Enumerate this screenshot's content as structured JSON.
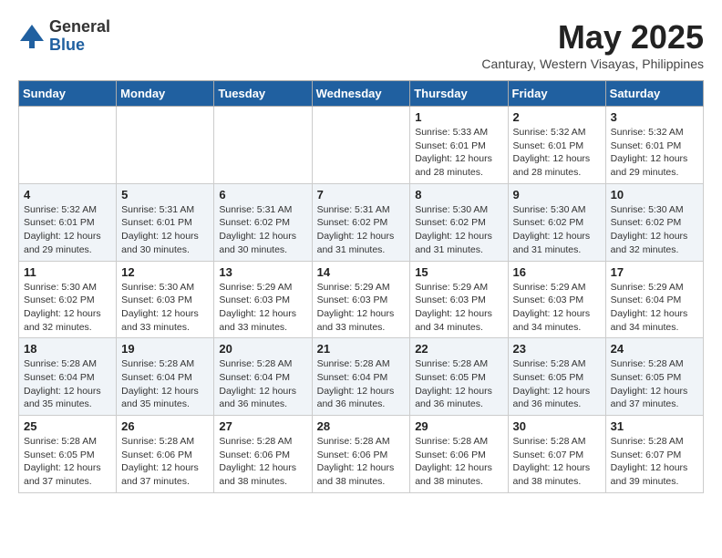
{
  "logo": {
    "general": "General",
    "blue": "Blue"
  },
  "title": "May 2025",
  "location": "Canturay, Western Visayas, Philippines",
  "days_header": [
    "Sunday",
    "Monday",
    "Tuesday",
    "Wednesday",
    "Thursday",
    "Friday",
    "Saturday"
  ],
  "weeks": [
    [
      {
        "day": "",
        "content": ""
      },
      {
        "day": "",
        "content": ""
      },
      {
        "day": "",
        "content": ""
      },
      {
        "day": "",
        "content": ""
      },
      {
        "day": "1",
        "content": "Sunrise: 5:33 AM\nSunset: 6:01 PM\nDaylight: 12 hours\nand 28 minutes."
      },
      {
        "day": "2",
        "content": "Sunrise: 5:32 AM\nSunset: 6:01 PM\nDaylight: 12 hours\nand 28 minutes."
      },
      {
        "day": "3",
        "content": "Sunrise: 5:32 AM\nSunset: 6:01 PM\nDaylight: 12 hours\nand 29 minutes."
      }
    ],
    [
      {
        "day": "4",
        "content": "Sunrise: 5:32 AM\nSunset: 6:01 PM\nDaylight: 12 hours\nand 29 minutes."
      },
      {
        "day": "5",
        "content": "Sunrise: 5:31 AM\nSunset: 6:01 PM\nDaylight: 12 hours\nand 30 minutes."
      },
      {
        "day": "6",
        "content": "Sunrise: 5:31 AM\nSunset: 6:02 PM\nDaylight: 12 hours\nand 30 minutes."
      },
      {
        "day": "7",
        "content": "Sunrise: 5:31 AM\nSunset: 6:02 PM\nDaylight: 12 hours\nand 31 minutes."
      },
      {
        "day": "8",
        "content": "Sunrise: 5:30 AM\nSunset: 6:02 PM\nDaylight: 12 hours\nand 31 minutes."
      },
      {
        "day": "9",
        "content": "Sunrise: 5:30 AM\nSunset: 6:02 PM\nDaylight: 12 hours\nand 31 minutes."
      },
      {
        "day": "10",
        "content": "Sunrise: 5:30 AM\nSunset: 6:02 PM\nDaylight: 12 hours\nand 32 minutes."
      }
    ],
    [
      {
        "day": "11",
        "content": "Sunrise: 5:30 AM\nSunset: 6:02 PM\nDaylight: 12 hours\nand 32 minutes."
      },
      {
        "day": "12",
        "content": "Sunrise: 5:30 AM\nSunset: 6:03 PM\nDaylight: 12 hours\nand 33 minutes."
      },
      {
        "day": "13",
        "content": "Sunrise: 5:29 AM\nSunset: 6:03 PM\nDaylight: 12 hours\nand 33 minutes."
      },
      {
        "day": "14",
        "content": "Sunrise: 5:29 AM\nSunset: 6:03 PM\nDaylight: 12 hours\nand 33 minutes."
      },
      {
        "day": "15",
        "content": "Sunrise: 5:29 AM\nSunset: 6:03 PM\nDaylight: 12 hours\nand 34 minutes."
      },
      {
        "day": "16",
        "content": "Sunrise: 5:29 AM\nSunset: 6:03 PM\nDaylight: 12 hours\nand 34 minutes."
      },
      {
        "day": "17",
        "content": "Sunrise: 5:29 AM\nSunset: 6:04 PM\nDaylight: 12 hours\nand 34 minutes."
      }
    ],
    [
      {
        "day": "18",
        "content": "Sunrise: 5:28 AM\nSunset: 6:04 PM\nDaylight: 12 hours\nand 35 minutes."
      },
      {
        "day": "19",
        "content": "Sunrise: 5:28 AM\nSunset: 6:04 PM\nDaylight: 12 hours\nand 35 minutes."
      },
      {
        "day": "20",
        "content": "Sunrise: 5:28 AM\nSunset: 6:04 PM\nDaylight: 12 hours\nand 36 minutes."
      },
      {
        "day": "21",
        "content": "Sunrise: 5:28 AM\nSunset: 6:04 PM\nDaylight: 12 hours\nand 36 minutes."
      },
      {
        "day": "22",
        "content": "Sunrise: 5:28 AM\nSunset: 6:05 PM\nDaylight: 12 hours\nand 36 minutes."
      },
      {
        "day": "23",
        "content": "Sunrise: 5:28 AM\nSunset: 6:05 PM\nDaylight: 12 hours\nand 36 minutes."
      },
      {
        "day": "24",
        "content": "Sunrise: 5:28 AM\nSunset: 6:05 PM\nDaylight: 12 hours\nand 37 minutes."
      }
    ],
    [
      {
        "day": "25",
        "content": "Sunrise: 5:28 AM\nSunset: 6:05 PM\nDaylight: 12 hours\nand 37 minutes."
      },
      {
        "day": "26",
        "content": "Sunrise: 5:28 AM\nSunset: 6:06 PM\nDaylight: 12 hours\nand 37 minutes."
      },
      {
        "day": "27",
        "content": "Sunrise: 5:28 AM\nSunset: 6:06 PM\nDaylight: 12 hours\nand 38 minutes."
      },
      {
        "day": "28",
        "content": "Sunrise: 5:28 AM\nSunset: 6:06 PM\nDaylight: 12 hours\nand 38 minutes."
      },
      {
        "day": "29",
        "content": "Sunrise: 5:28 AM\nSunset: 6:06 PM\nDaylight: 12 hours\nand 38 minutes."
      },
      {
        "day": "30",
        "content": "Sunrise: 5:28 AM\nSunset: 6:07 PM\nDaylight: 12 hours\nand 38 minutes."
      },
      {
        "day": "31",
        "content": "Sunrise: 5:28 AM\nSunset: 6:07 PM\nDaylight: 12 hours\nand 39 minutes."
      }
    ]
  ]
}
